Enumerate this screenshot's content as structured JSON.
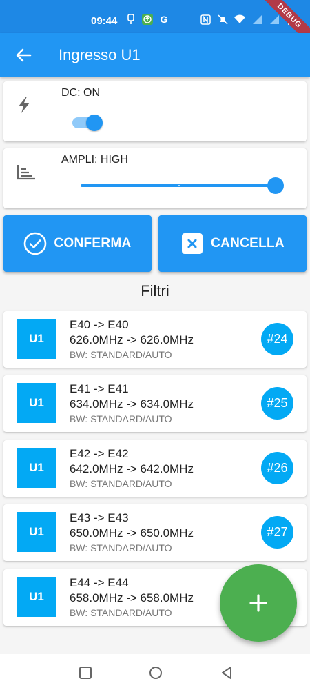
{
  "status_bar": {
    "time": "09:44",
    "left_icons": [
      "usb-icon",
      "upload-icon",
      "google-icon"
    ],
    "google_letter": "G",
    "right_icons": [
      "nfc-icon",
      "mute-icon",
      "wifi-icon",
      "signal-icon",
      "signal-icon",
      "battery-icon"
    ]
  },
  "debug_banner": "DEBUG",
  "app_bar": {
    "title": "Ingresso U1"
  },
  "dc": {
    "label": "DC: ON",
    "switch_on": true
  },
  "ampli": {
    "label": "AMPLI: HIGH",
    "slider_value": 1.0
  },
  "buttons": {
    "confirm_label": "CONFERMA",
    "cancel_label": "CANCELLA"
  },
  "filters_title": "Filtri",
  "filters": [
    {
      "badge": "U1",
      "channel": "E40 -> E40",
      "freq": "626.0MHz -> 626.0MHz",
      "bw": "BW: STANDARD/AUTO",
      "number": "#24"
    },
    {
      "badge": "U1",
      "channel": "E41 -> E41",
      "freq": "634.0MHz -> 634.0MHz",
      "bw": "BW: STANDARD/AUTO",
      "number": "#25"
    },
    {
      "badge": "U1",
      "channel": "E42 -> E42",
      "freq": "642.0MHz -> 642.0MHz",
      "bw": "BW: STANDARD/AUTO",
      "number": "#26"
    },
    {
      "badge": "U1",
      "channel": "E43 -> E43",
      "freq": "650.0MHz -> 650.0MHz",
      "bw": "BW: STANDARD/AUTO",
      "number": "#27"
    },
    {
      "badge": "U1",
      "channel": "E44 -> E44",
      "freq": "658.0MHz -> 658.0MHz",
      "bw": "BW: STANDARD/AUTO",
      "number": ""
    }
  ],
  "colors": {
    "primary": "#2196f3",
    "status_bar": "#1e88e5",
    "badge": "#03a9f4",
    "fab": "#4caf50"
  }
}
